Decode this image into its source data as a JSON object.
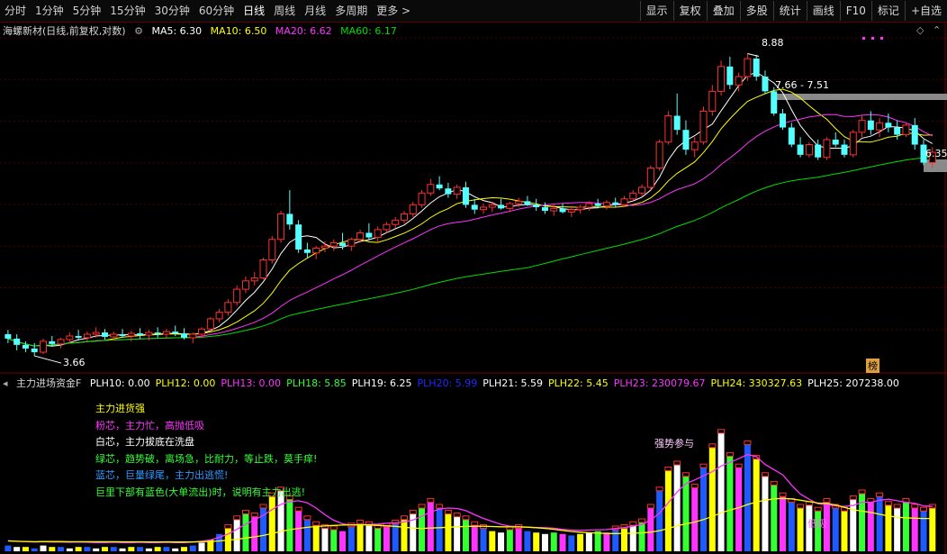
{
  "toolbar": {
    "periods": [
      "分时",
      "1分钟",
      "5分钟",
      "15分钟",
      "30分钟",
      "60分钟",
      "日线",
      "周线",
      "月线",
      "多周期",
      "更多 >"
    ],
    "active_index": 6,
    "right_buttons": [
      "显示",
      "复权",
      "叠加",
      "多股",
      "统计",
      "画线",
      "F10",
      "标记",
      "+自选"
    ]
  },
  "price_legend": {
    "title": "海螺新材(日线,前复权,对数)",
    "ma5": "MA5: 6.30",
    "ma10": "MA10: 6.50",
    "ma20": "MA20: 6.62",
    "ma60": "MA60: 6.17",
    "ma5_color": "#ffffff",
    "ma10_color": "#ffff00",
    "ma20_color": "#ff33ff",
    "ma60_color": "#00dd00"
  },
  "price_annotations": {
    "high": "8.88",
    "low": "3.66",
    "range": "7.66 - 7.51",
    "right_price": "6.35",
    "badge": "榜"
  },
  "indicator_legend": {
    "name": "主力进场资金F",
    "items": [
      {
        "text": "PLH10: 0.00",
        "color": "#ffffff"
      },
      {
        "text": "PLH12: 0.00",
        "color": "#ffff00"
      },
      {
        "text": "PLH13: 0.00",
        "color": "#ff33ff"
      },
      {
        "text": "PLH18: 5.85",
        "color": "#33ff33"
      },
      {
        "text": "PLH19: 6.25",
        "color": "#ffffff"
      },
      {
        "text": "PLH20: 5.99",
        "color": "#1e2aff"
      },
      {
        "text": "PLH21: 5.59",
        "color": "#ffffff"
      },
      {
        "text": "PLH22: 5.45",
        "color": "#ffff00"
      },
      {
        "text": "PLH23: 230079.67",
        "color": "#ff33ff"
      },
      {
        "text": "PLH24: 330327.63",
        "color": "#ffff00"
      },
      {
        "text": "PLH25: 207238.00",
        "color": "#ffffff"
      }
    ]
  },
  "notes": [
    {
      "text": "主力进货强",
      "color": "#ffff00"
    },
    {
      "text": "粉芯，主力忙，高抛低吸",
      "color": "#ff33ff"
    },
    {
      "text": "白芯，主力拔底在洗盘",
      "color": "#ffffff"
    },
    {
      "text": "绿芯，趋势破，离场急，比耐力，等止跌，莫手痒!",
      "color": "#33ff33"
    },
    {
      "text": "蓝芯，巨量绿尾，主力出逃慌!",
      "color": "#3399ff"
    },
    {
      "text": "巨里下部有蓝色(大单流出)时，说明有主力出逃!",
      "color": "#33ff33"
    }
  ],
  "indicator_annotations": {
    "strong": "强势参与",
    "low_buy": "低吸"
  },
  "chart_data": {
    "type": "candlestick",
    "scale": "log",
    "ylim": [
      3.5,
      9.3
    ],
    "ohlc": [
      [
        3.9,
        3.95,
        3.8,
        3.85
      ],
      [
        3.85,
        3.9,
        3.72,
        3.78
      ],
      [
        3.78,
        3.82,
        3.7,
        3.74
      ],
      [
        3.74,
        3.8,
        3.66,
        3.7
      ],
      [
        3.7,
        3.85,
        3.68,
        3.82
      ],
      [
        3.82,
        3.88,
        3.76,
        3.79
      ],
      [
        3.79,
        3.86,
        3.74,
        3.84
      ],
      [
        3.84,
        3.92,
        3.8,
        3.88
      ],
      [
        3.88,
        3.95,
        3.83,
        3.86
      ],
      [
        3.86,
        3.93,
        3.82,
        3.9
      ],
      [
        3.9,
        3.98,
        3.86,
        3.92
      ],
      [
        3.92,
        3.96,
        3.84,
        3.87
      ],
      [
        3.87,
        3.93,
        3.83,
        3.9
      ],
      [
        3.9,
        3.96,
        3.86,
        3.88
      ],
      [
        3.88,
        3.94,
        3.82,
        3.91
      ],
      [
        3.91,
        3.97,
        3.85,
        3.89
      ],
      [
        3.89,
        3.95,
        3.83,
        3.92
      ],
      [
        3.92,
        3.98,
        3.86,
        3.9
      ],
      [
        3.9,
        3.96,
        3.85,
        3.93
      ],
      [
        3.93,
        4.0,
        3.88,
        3.91
      ],
      [
        3.91,
        3.97,
        3.84,
        3.86
      ],
      [
        3.86,
        3.92,
        3.8,
        3.9
      ],
      [
        3.9,
        3.98,
        3.86,
        3.96
      ],
      [
        3.96,
        4.1,
        3.94,
        4.08
      ],
      [
        4.08,
        4.2,
        4.04,
        4.16
      ],
      [
        4.16,
        4.32,
        4.12,
        4.28
      ],
      [
        4.28,
        4.5,
        4.24,
        4.45
      ],
      [
        4.45,
        4.62,
        4.4,
        4.56
      ],
      [
        4.56,
        4.68,
        4.5,
        4.6
      ],
      [
        4.6,
        4.88,
        4.58,
        4.85
      ],
      [
        4.85,
        5.2,
        4.8,
        5.15
      ],
      [
        5.15,
        5.6,
        5.1,
        5.55
      ],
      [
        5.55,
        5.95,
        5.3,
        5.38
      ],
      [
        5.38,
        5.45,
        4.95,
        5.0
      ],
      [
        5.0,
        5.1,
        4.88,
        4.95
      ],
      [
        4.95,
        5.05,
        4.86,
        5.02
      ],
      [
        5.02,
        5.12,
        4.96,
        5.05
      ],
      [
        5.05,
        5.15,
        4.98,
        5.1
      ],
      [
        5.1,
        5.25,
        5.0,
        5.05
      ],
      [
        5.05,
        5.18,
        4.98,
        5.15
      ],
      [
        5.15,
        5.3,
        5.1,
        5.25
      ],
      [
        5.25,
        5.4,
        5.15,
        5.18
      ],
      [
        5.18,
        5.35,
        5.12,
        5.3
      ],
      [
        5.3,
        5.42,
        5.25,
        5.38
      ],
      [
        5.38,
        5.5,
        5.32,
        5.45
      ],
      [
        5.45,
        5.6,
        5.4,
        5.55
      ],
      [
        5.55,
        5.75,
        5.5,
        5.7
      ],
      [
        5.7,
        5.95,
        5.65,
        5.9
      ],
      [
        5.9,
        6.15,
        5.85,
        6.05
      ],
      [
        6.05,
        6.2,
        5.95,
        5.98
      ],
      [
        5.98,
        6.08,
        5.82,
        5.88
      ],
      [
        5.88,
        6.05,
        5.8,
        6.0
      ],
      [
        6.0,
        6.1,
        5.65,
        5.7
      ],
      [
        5.7,
        5.8,
        5.55,
        5.62
      ],
      [
        5.62,
        5.72,
        5.55,
        5.66
      ],
      [
        5.66,
        5.75,
        5.58,
        5.7
      ],
      [
        5.7,
        5.8,
        5.62,
        5.64
      ],
      [
        5.64,
        5.75,
        5.58,
        5.72
      ],
      [
        5.72,
        5.82,
        5.66,
        5.76
      ],
      [
        5.76,
        5.85,
        5.68,
        5.7
      ],
      [
        5.7,
        5.8,
        5.6,
        5.66
      ],
      [
        5.66,
        5.74,
        5.55,
        5.6
      ],
      [
        5.6,
        5.7,
        5.52,
        5.64
      ],
      [
        5.64,
        5.72,
        5.56,
        5.58
      ],
      [
        5.58,
        5.68,
        5.5,
        5.62
      ],
      [
        5.62,
        5.7,
        5.56,
        5.66
      ],
      [
        5.66,
        5.76,
        5.6,
        5.72
      ],
      [
        5.72,
        5.8,
        5.64,
        5.68
      ],
      [
        5.68,
        5.78,
        5.62,
        5.74
      ],
      [
        5.74,
        5.82,
        5.66,
        5.7
      ],
      [
        5.7,
        5.85,
        5.66,
        5.8
      ],
      [
        5.8,
        5.95,
        5.76,
        5.9
      ],
      [
        5.9,
        6.05,
        5.85,
        6.0
      ],
      [
        6.0,
        6.4,
        5.95,
        6.35
      ],
      [
        6.35,
        6.9,
        6.3,
        6.85
      ],
      [
        6.85,
        7.5,
        6.8,
        7.4
      ],
      [
        7.4,
        7.9,
        7.0,
        7.1
      ],
      [
        7.1,
        7.3,
        6.6,
        6.7
      ],
      [
        6.7,
        6.95,
        6.55,
        6.85
      ],
      [
        6.85,
        7.6,
        6.8,
        7.5
      ],
      [
        7.5,
        8.1,
        7.4,
        7.95
      ],
      [
        7.95,
        8.7,
        7.85,
        8.55
      ],
      [
        8.55,
        8.8,
        8.0,
        8.1
      ],
      [
        8.1,
        8.4,
        7.95,
        8.3
      ],
      [
        8.3,
        8.88,
        8.2,
        8.75
      ],
      [
        8.75,
        8.85,
        8.2,
        8.3
      ],
      [
        8.3,
        8.45,
        7.9,
        7.95
      ],
      [
        7.95,
        8.05,
        7.4,
        7.45
      ],
      [
        7.45,
        7.55,
        7.1,
        7.15
      ],
      [
        7.15,
        7.25,
        6.75,
        6.8
      ],
      [
        6.8,
        6.95,
        6.55,
        6.6
      ],
      [
        6.6,
        6.85,
        6.55,
        6.8
      ],
      [
        6.8,
        6.9,
        6.5,
        6.55
      ],
      [
        6.55,
        6.95,
        6.5,
        6.9
      ],
      [
        6.9,
        7.05,
        6.75,
        6.8
      ],
      [
        6.8,
        6.9,
        6.55,
        6.6
      ],
      [
        6.6,
        7.1,
        6.55,
        7.05
      ],
      [
        7.05,
        7.4,
        6.95,
        7.3
      ],
      [
        7.3,
        7.5,
        7.0,
        7.1
      ],
      [
        7.1,
        7.35,
        6.95,
        7.25
      ],
      [
        7.25,
        7.45,
        7.05,
        7.15
      ],
      [
        7.15,
        7.3,
        6.9,
        7.0
      ],
      [
        7.0,
        7.25,
        6.95,
        7.2
      ],
      [
        7.2,
        7.35,
        6.7,
        6.8
      ],
      [
        6.8,
        6.9,
        6.4,
        6.45
      ],
      [
        6.45,
        6.75,
        6.35,
        6.65
      ]
    ],
    "volume": [
      4,
      3,
      3,
      2,
      4,
      3,
      3,
      2,
      3,
      3,
      2,
      3,
      3,
      2,
      3,
      3,
      2,
      3,
      3,
      2,
      3,
      4,
      6,
      8,
      12,
      16,
      22,
      26,
      24,
      30,
      38,
      42,
      36,
      28,
      22,
      18,
      16,
      15,
      14,
      17,
      19,
      18,
      16,
      17,
      19,
      22,
      26,
      30,
      34,
      30,
      26,
      24,
      22,
      18,
      16,
      14,
      13,
      15,
      16,
      14,
      13,
      12,
      13,
      12,
      11,
      12,
      13,
      14,
      13,
      15,
      16,
      18,
      20,
      30,
      42,
      56,
      60,
      52,
      44,
      58,
      72,
      82,
      66,
      58,
      74,
      64,
      52,
      46,
      38,
      34,
      30,
      32,
      28,
      34,
      30,
      28,
      36,
      40,
      34,
      38,
      32,
      30,
      34,
      30,
      28,
      30
    ]
  }
}
